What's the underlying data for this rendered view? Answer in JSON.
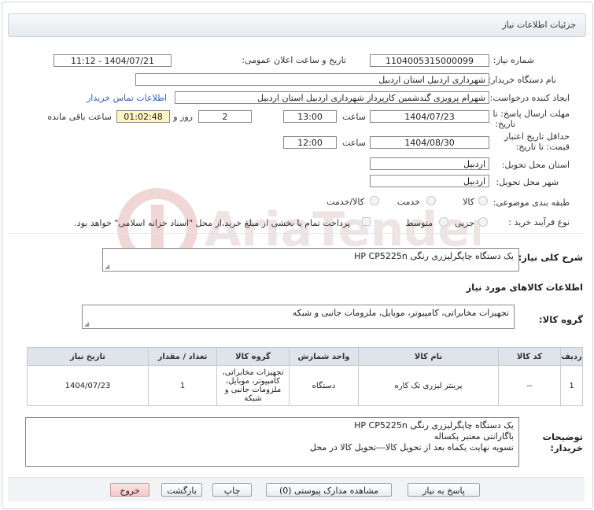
{
  "header": {
    "title": "جزئیات اطلاعات نیاز"
  },
  "form": {
    "need_number_label": "شماره نیاز:",
    "need_number": "1104005315000099",
    "announce_label": "تاریخ و ساعت اعلان عمومی:",
    "announce_value": "1404/07/21 - 11:12",
    "buyer_org_label": "نام دستگاه خریدار:",
    "buyer_org": "شهرداری اردبیل استان اردبیل",
    "creator_label": "ایجاد کننده درخواست:",
    "creator": "شهرام پرویزی گندشمین کارپرداز شهرداری اردبیل استان اردبیل",
    "contact_link": "اطلاعات تماس خریدار",
    "deadline_label_1": "مهلت ارسال پاسخ: تا",
    "deadline_label_2": "تاریخ:",
    "deadline_date": "1404/07/23",
    "time_label": "ساعت",
    "deadline_time": "13:00",
    "days_value": "2",
    "days_label": "روز و",
    "remaining_value": "01:02:48",
    "remaining_label": "ساعت باقی مانده",
    "validity_label_1": "حداقل تاریخ اعتبار",
    "validity_label_2": "قیمت: تا تاریخ:",
    "validity_date": "1404/08/30",
    "validity_time": "12:00",
    "province_label": "استان محل تحویل:",
    "province": "اردبیل",
    "city_label": "شهر محل تحویل:",
    "city": "اردبیل",
    "category_label": "طبقه بندی موضوعی:",
    "category_options": [
      "کالا",
      "خدمت",
      "کالا/خدمت"
    ],
    "process_label": "نوع فرآیند خرید :",
    "process_options": [
      "جزیی",
      "متوسط"
    ],
    "payment_note": "پرداخت تمام یا بخشی از مبلغ خرید،از محل \"اسناد خزانه اسلامی\" خواهد بود.",
    "summary_label": "شرح کلی نیاز:",
    "summary": "یک دستگاه چاپگرلیزری رنگی  HP  CP5225n",
    "goods_info_title": "اطلاعات کالاهای مورد نیاز",
    "goods_group_label": "گروه کالا:",
    "goods_group": "تجهیزات مخابراتی، کامپیوتر، موبایل، ملزومات جانبی و شبکه"
  },
  "table": {
    "headers": [
      "ردیف",
      "کد کالا",
      "نام کالا",
      "واحد شمارش",
      "گروه کالا",
      "تعداد / مقدار",
      "تاریخ نیاز"
    ],
    "rows": [
      [
        "1",
        "--",
        "پرینتر لیزری تک کاره",
        "دستگاه",
        "تجهیزات مخابراتی، کامپیوتر، موبایل، ملزومات جانبی و شبکه",
        "1",
        "1404/07/23"
      ]
    ]
  },
  "buyer_notes": {
    "label_1": "توضیحات",
    "label_2": "خریدار:",
    "lines": [
      "یک دستگاه چاپگرلیزری رنگی  HP  CP5225n",
      " باگارانتی معتبر یکساله",
      "تسویه نهایت یکماه بعد از تحویل کالا---تحویل کالا در محل"
    ]
  },
  "buttons": {
    "reply": "پاسخ به نیاز",
    "docs": "مشاهده مدارک پیوستی (0)",
    "print": "چاپ",
    "back": "بازگشت",
    "exit": "خروج"
  },
  "watermark": {
    "text": "AriaTender.neT"
  },
  "colors": {
    "link": "#2b62c7",
    "remaining_bg": "#fdf6c3",
    "table_header_bg": "#dfe4ea",
    "exit_bg": "#f6c8c8"
  }
}
